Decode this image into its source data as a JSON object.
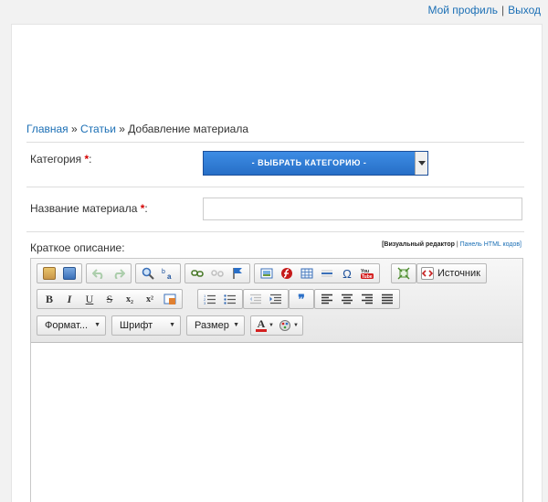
{
  "topbar": {
    "profile": "Мой профиль",
    "separator": "|",
    "logout": "Выход"
  },
  "breadcrumb": {
    "home": "Главная",
    "sep1": " » ",
    "articles": "Статьи",
    "sep2": " » ",
    "current": "Добавление материала"
  },
  "form": {
    "category_label": "Категория",
    "required_mark": "*",
    "colon": ":",
    "category_select": "- ВЫБРАТЬ КАТЕГОРИЮ -",
    "title_label": "Название материала",
    "title_value": "",
    "desc_label": "Краткое описание:"
  },
  "editor_links": {
    "visual": "[Визуальный редактор",
    "sep": " | ",
    "html": "Панель HTML кодов]"
  },
  "toolbar": {
    "source_label": "Источник",
    "format_label": "Формат...",
    "font_label": "Шрифт",
    "size_label": "Размер",
    "bold": "B",
    "italic": "I",
    "underline": "U",
    "strike": "S",
    "subscript": "x₂",
    "superscript": "x²",
    "quote": "❞",
    "omega": "Ω",
    "text_color": "A"
  },
  "colors": {
    "link": "#1b6fb5",
    "required": "#d40000",
    "select_bg": "#2f7ed8"
  }
}
